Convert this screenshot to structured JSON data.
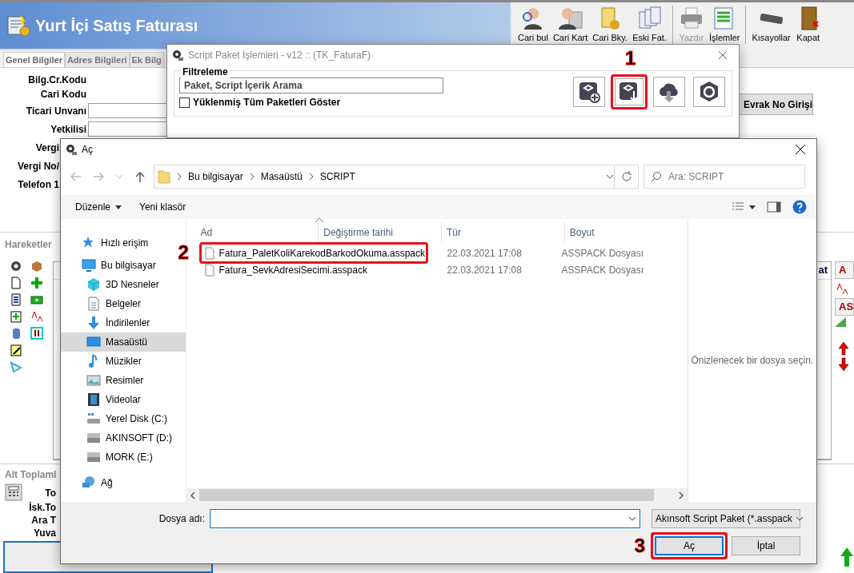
{
  "app": {
    "title": "Yurt İçi Satış Faturası",
    "toolbar": [
      {
        "label": "Cari bul",
        "disabled": false
      },
      {
        "label": "Cari Kart",
        "disabled": false
      },
      {
        "label": "Cari Bky.",
        "disabled": false
      },
      {
        "label": "Eski Fat.",
        "disabled": false
      },
      {
        "label": "Yazdır",
        "disabled": true
      },
      {
        "label": "İşlemler",
        "disabled": false
      },
      {
        "label": "Kısayollar",
        "disabled": false
      },
      {
        "label": "Kapat",
        "disabled": false
      }
    ],
    "tabs": [
      {
        "label": "Genel Bilgiler",
        "selected": true
      },
      {
        "label": "Adres Bilgileri",
        "selected": false
      },
      {
        "label": "Ek Bilg",
        "selected": false
      }
    ],
    "fields": [
      {
        "label": "Bilg.Cr.Kodu",
        "kind": "text"
      },
      {
        "label": "Cari Kodu",
        "kind": "text"
      },
      {
        "label": "Ticari Unvanı",
        "kind": "input"
      },
      {
        "label": "Yetkilisi",
        "kind": "input"
      },
      {
        "label": "Vergi",
        "kind": "covered"
      },
      {
        "label": "Vergi No/",
        "kind": "covered"
      },
      {
        "label": "Telefon 1",
        "kind": "covered"
      }
    ],
    "evrak_button": "Evrak No Girişi",
    "movements_title": "Hareketler",
    "grid_header": "at",
    "side_buttons": [
      "A",
      "AS"
    ],
    "totals_title": "Alt Toplaml",
    "totals": [
      "To",
      "İsk.To",
      "Ara T",
      "Yuva"
    ]
  },
  "script_dialog": {
    "title": "Script Paket İşlemleri - v12 :: (TK_FaturaF)",
    "group": "Filtreleme",
    "search": {
      "placeholder": "Paket, Script İçerik Arama"
    },
    "checkbox": {
      "label": "Yüklenmiş Tüm Paketleri Göster",
      "checked": false
    },
    "tool_buttons": [
      {
        "highlighted": false
      },
      {
        "highlighted": true,
        "step": "1"
      },
      {
        "highlighted": false
      },
      {
        "highlighted": false
      }
    ]
  },
  "open_dialog": {
    "title": "Aç",
    "breadcrumb": [
      "Bu bilgisayar",
      "Masaüstü",
      "SCRIPT"
    ],
    "search": {
      "placeholder": "Ara: SCRIPT"
    },
    "commands": [
      {
        "label": "Düzenle",
        "dropdown": true
      },
      {
        "label": "Yeni klasör",
        "dropdown": false
      }
    ],
    "nav": [
      {
        "label": "Hızlı erişim",
        "selected": false
      },
      {
        "label": "Bu bilgisayar",
        "selected": false,
        "children": [
          {
            "label": "3D Nesneler",
            "selected": false
          },
          {
            "label": "Belgeler",
            "selected": false
          },
          {
            "label": "İndirilenler",
            "selected": false
          },
          {
            "label": "Masaüstü",
            "selected": true
          },
          {
            "label": "Müzikler",
            "selected": false
          },
          {
            "label": "Resimler",
            "selected": false
          },
          {
            "label": "Videolar",
            "selected": false
          },
          {
            "label": "Yerel Disk (C:)",
            "selected": false
          },
          {
            "label": "AKINSOFT (D:)",
            "selected": false
          },
          {
            "label": "MORK (E:)",
            "selected": false
          }
        ]
      },
      {
        "label": "Ağ",
        "selected": false
      }
    ],
    "columns": [
      "Ad",
      "Değiştirme tarihi",
      "Tür",
      "Boyut"
    ],
    "files": [
      {
        "name": "Fatura_PaletKoliKarekodBarkodOkuma.asspack",
        "modified": "22.03.2021 17:08",
        "type": "ASSPACK Dosyası",
        "highlighted": true,
        "step": "2"
      },
      {
        "name": "Fatura_SevkAdresiSecimi.asspack",
        "modified": "22.03.2021 17:08",
        "type": "ASSPACK Dosyası",
        "highlighted": false
      }
    ],
    "preview_text": "Önizlenecek bir dosya seçin.",
    "filename_label": "Dosya adı:",
    "filter": "Akınsoft Script Paket (*.asspack",
    "buttons": [
      {
        "label": "Aç",
        "highlighted": true,
        "step": "3"
      },
      {
        "label": "İptal",
        "highlighted": false
      }
    ]
  }
}
